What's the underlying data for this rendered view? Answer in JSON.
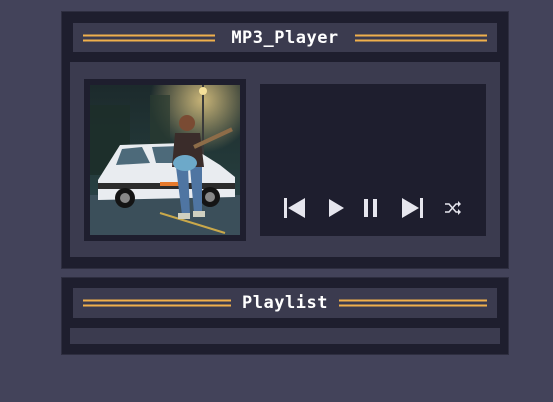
{
  "player": {
    "title": "MP3_Player",
    "album_art_icon": "album-cover-image",
    "controls": [
      {
        "name": "previous-icon",
        "label": "Previous"
      },
      {
        "name": "play-icon",
        "label": "Play"
      },
      {
        "name": "pause-icon",
        "label": "Pause"
      },
      {
        "name": "next-icon",
        "label": "Next"
      },
      {
        "name": "shuffle-icon",
        "label": "Shuffle"
      }
    ]
  },
  "playlist": {
    "title": "Playlist",
    "items": []
  },
  "colors": {
    "background": "#43435a",
    "frame": "#1e1e2e",
    "panel": "#3b3b4f",
    "accent": "#f0b04c",
    "text": "#ffffff",
    "icon": "#e6e6ee"
  }
}
